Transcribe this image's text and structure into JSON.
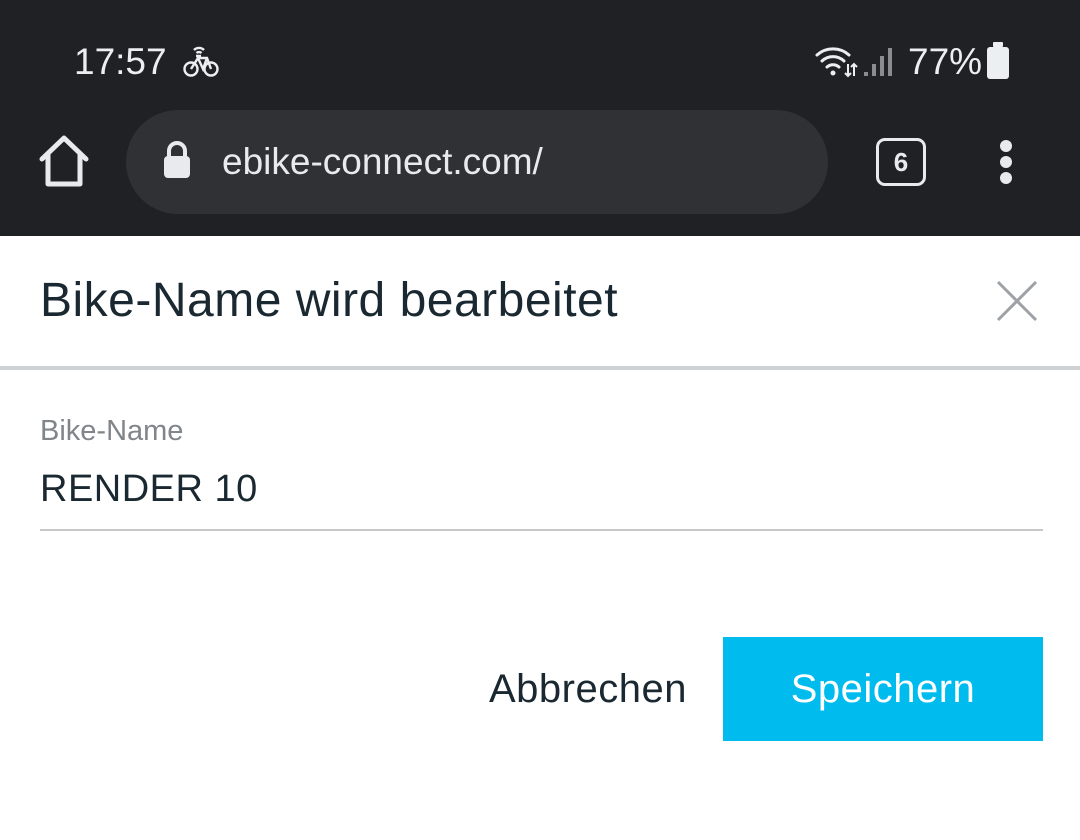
{
  "status_bar": {
    "time": "17:57",
    "battery_percent": "77%",
    "icons": [
      "bicycle-icon",
      "wifi-icon",
      "cell-signal-icon",
      "battery-icon"
    ]
  },
  "browser": {
    "url": "ebike-connect.com/",
    "tab_count": "6",
    "icons": [
      "home-icon",
      "lock-icon",
      "tabs-icon",
      "more-vert-icon"
    ]
  },
  "dialog": {
    "title": "Bike-Name wird bearbeitet",
    "close_icon": "close-icon",
    "field": {
      "label": "Bike-Name",
      "value": "RENDER 10"
    },
    "cancel_label": "Abbrechen",
    "save_label": "Speichern"
  },
  "colors": {
    "browser_chrome": "#202124",
    "url_bar": "#303134",
    "accent": "#00bcee",
    "text_dark": "#1a2831",
    "label_gray": "#80858a"
  }
}
